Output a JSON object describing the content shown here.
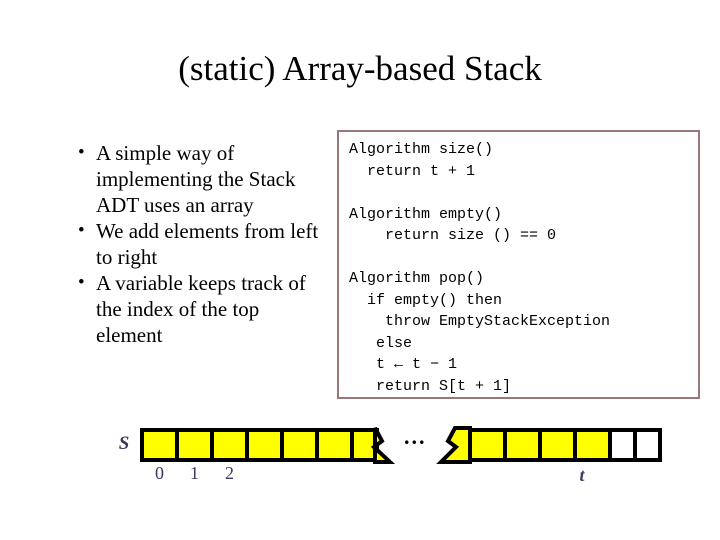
{
  "slide": {
    "title": "(static) Array-based Stack",
    "background_color": "#ffffff"
  },
  "bullets": [
    {
      "marker": "•",
      "text": "A simple way of implementing the Stack ADT uses an array"
    },
    {
      "marker": "•",
      "text": "We add elements from left to right"
    },
    {
      "marker": "•",
      "text": "A variable keeps track of the  index of the top element"
    }
  ],
  "code_box": {
    "border_color": "#9c7676",
    "background_color": "#ffffff",
    "code": "Algorithm size()\n  return t + 1\n\nAlgorithm empty()\n    return size () == 0\n\nAlgorithm pop()\n  if empty() then\n    throw EmptyStackException\n   else\n   t ← t − 1\n   return S[t + 1]"
  },
  "array_diagram": {
    "array_label": "S",
    "top_pointer_label": "t",
    "ellipsis": "...",
    "index_labels": [
      "0",
      "1",
      "2"
    ],
    "cell_fill_color": "#ffff00",
    "cell_empty_color": "#ffffff",
    "cell_border_color": "#000000",
    "label_color": "#393961",
    "left_segment": {
      "full_cells": 7,
      "torn_partial_cell": true
    },
    "right_segment": {
      "torn_partial_cell": true,
      "filled_cells": 4,
      "empty_cells": 2
    }
  }
}
